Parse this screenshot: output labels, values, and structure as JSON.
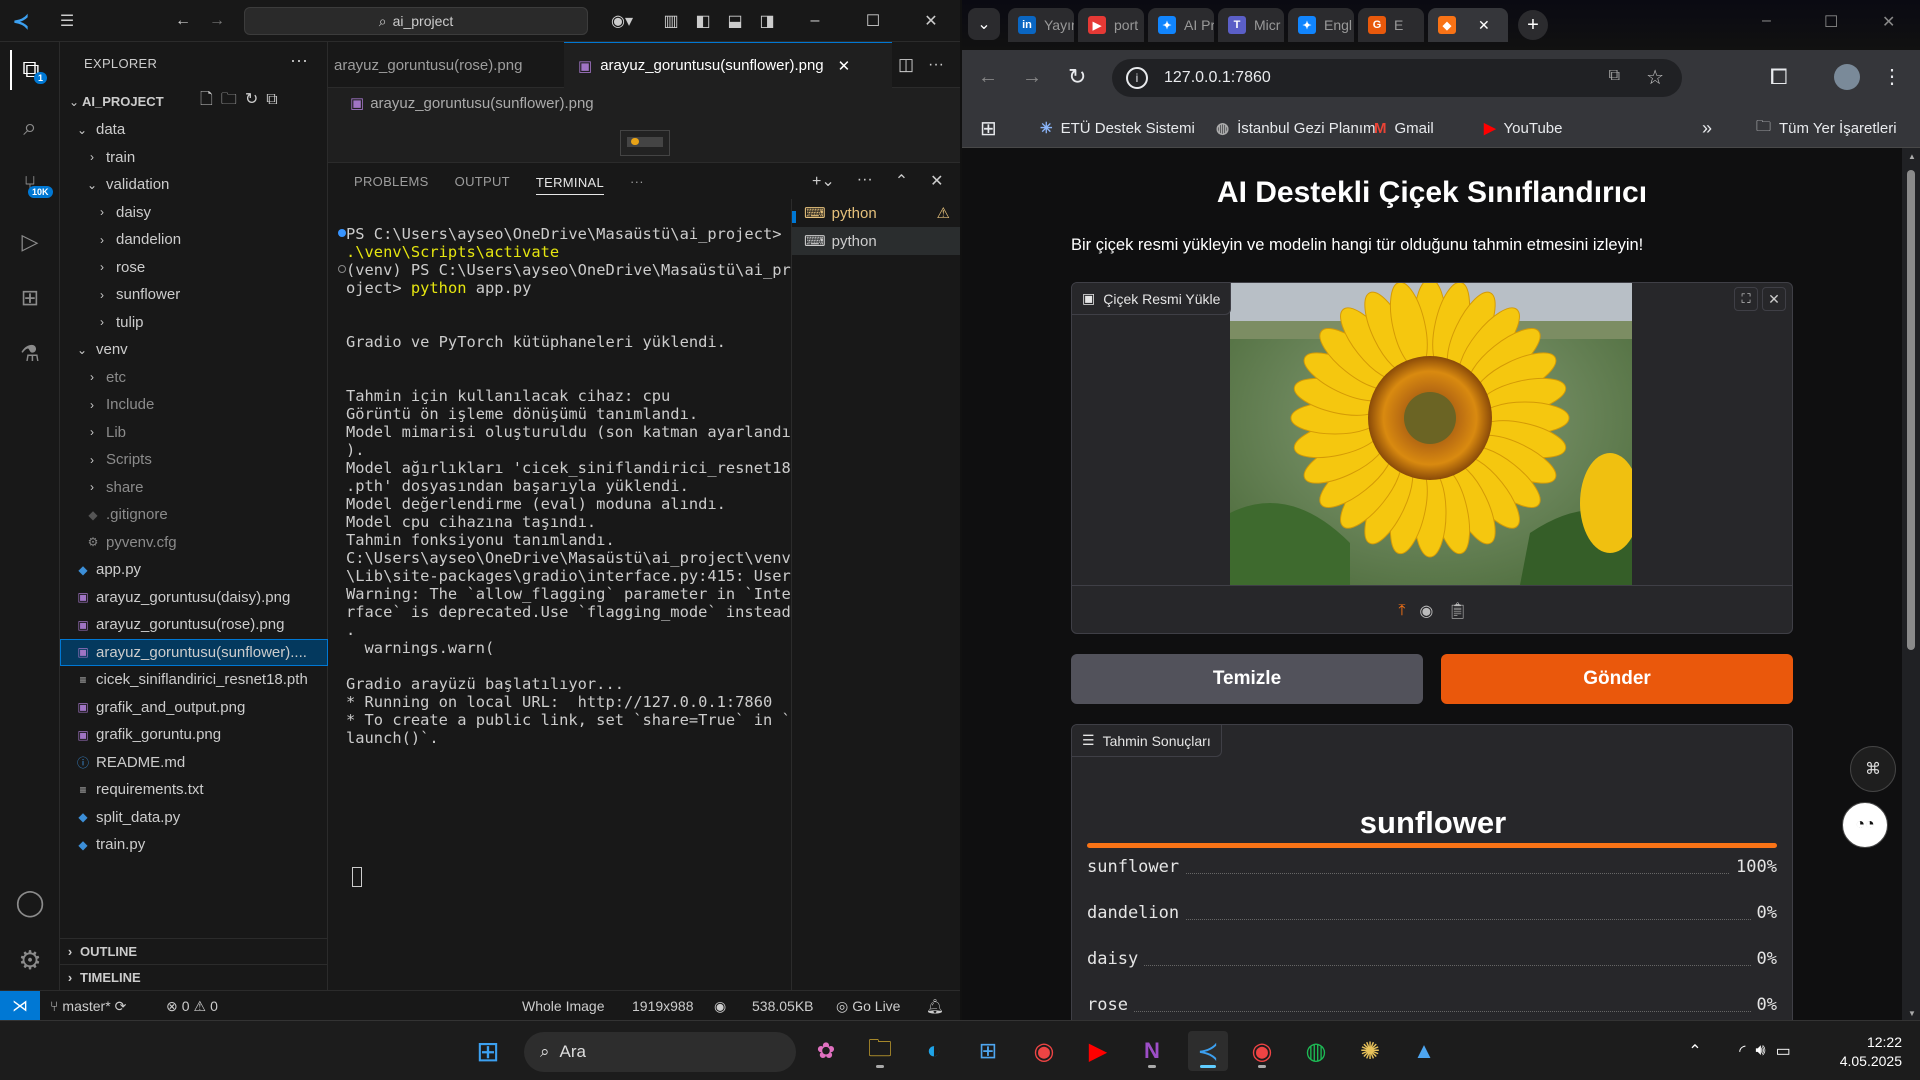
{
  "vscode": {
    "search_text": "ai_project",
    "explorer_label": "EXPLORER",
    "project_name": "AI_PROJECT",
    "source_control_badge": "10K",
    "explorer_badge": "1",
    "tree": [
      {
        "label": "data",
        "depth": 1,
        "type": "folder-open"
      },
      {
        "label": "train",
        "depth": 2,
        "type": "folder"
      },
      {
        "label": "validation",
        "depth": 2,
        "type": "folder-open"
      },
      {
        "label": "daisy",
        "depth": 3,
        "type": "folder"
      },
      {
        "label": "dandelion",
        "depth": 3,
        "type": "folder"
      },
      {
        "label": "rose",
        "depth": 3,
        "type": "folder"
      },
      {
        "label": "sunflower",
        "depth": 3,
        "type": "folder"
      },
      {
        "label": "tulip",
        "depth": 3,
        "type": "folder"
      },
      {
        "label": "venv",
        "depth": 1,
        "type": "folder-open"
      },
      {
        "label": "etc",
        "depth": 2,
        "type": "folder",
        "dim": true
      },
      {
        "label": "Include",
        "depth": 2,
        "type": "folder",
        "dim": true
      },
      {
        "label": "Lib",
        "depth": 2,
        "type": "folder",
        "dim": true
      },
      {
        "label": "Scripts",
        "depth": 2,
        "type": "folder",
        "dim": true
      },
      {
        "label": "share",
        "depth": 2,
        "type": "folder",
        "dim": true
      },
      {
        "label": ".gitignore",
        "depth": 2,
        "type": "gitignore",
        "dim": true
      },
      {
        "label": "pyvenv.cfg",
        "depth": 2,
        "type": "cfg",
        "dim": true
      },
      {
        "label": "app.py",
        "depth": 1,
        "type": "python"
      },
      {
        "label": "arayuz_goruntusu(daisy).png",
        "depth": 1,
        "type": "image"
      },
      {
        "label": "arayuz_goruntusu(rose).png",
        "depth": 1,
        "type": "image"
      },
      {
        "label": "arayuz_goruntusu(sunflower)....",
        "depth": 1,
        "type": "image",
        "selected": true
      },
      {
        "label": "cicek_siniflandirici_resnet18.pth",
        "depth": 1,
        "type": "text"
      },
      {
        "label": "grafik_and_output.png",
        "depth": 1,
        "type": "image"
      },
      {
        "label": "grafik_goruntu.png",
        "depth": 1,
        "type": "image"
      },
      {
        "label": "README.md",
        "depth": 1,
        "type": "info"
      },
      {
        "label": "requirements.txt",
        "depth": 1,
        "type": "text"
      },
      {
        "label": "split_data.py",
        "depth": 1,
        "type": "python"
      },
      {
        "label": "train.py",
        "depth": 1,
        "type": "python"
      }
    ],
    "outline_label": "OUTLINE",
    "timeline_label": "TIMELINE",
    "tab_inactive": "arayuz_goruntusu(rose).png",
    "tab_active": "arayuz_goruntusu(sunflower).png",
    "breadcrumb": "arayuz_goruntusu(sunflower).png",
    "panel_tabs": [
      "PROBLEMS",
      "OUTPUT",
      "TERMINAL"
    ],
    "terminal_lines": [
      {
        "parts": [
          [
            "PS C:\\Users\\ayseo\\OneDrive\\Masaüstü\\ai_project> ",
            "#cccccc"
          ]
        ]
      },
      {
        "parts": [
          [
            ".\\venv\\Scripts\\activate",
            "#e5e510"
          ]
        ]
      },
      {
        "parts": [
          [
            "(venv) ",
            "#cccccc"
          ],
          [
            "PS C:\\Users\\ayseo\\OneDrive\\Masaüstü\\ai_pr",
            "#cccccc"
          ]
        ]
      },
      {
        "parts": [
          [
            "oject> ",
            "#cccccc"
          ],
          [
            "python",
            "#e5e510"
          ],
          [
            " app.py",
            "#cccccc"
          ]
        ]
      },
      {
        "parts": [
          [
            "",
            "#cccccc"
          ]
        ]
      },
      {
        "parts": [
          [
            "",
            "#cccccc"
          ]
        ]
      },
      {
        "parts": [
          [
            "Gradio ve PyTorch kütüphaneleri yüklendi.",
            "#cccccc"
          ]
        ]
      },
      {
        "parts": [
          [
            "",
            "#cccccc"
          ]
        ]
      },
      {
        "parts": [
          [
            "",
            "#cccccc"
          ]
        ]
      },
      {
        "parts": [
          [
            "Tahmin için kullanılacak cihaz: cpu",
            "#cccccc"
          ]
        ]
      },
      {
        "parts": [
          [
            "Görüntü ön işleme dönüşümü tanımlandı.",
            "#cccccc"
          ]
        ]
      },
      {
        "parts": [
          [
            "Model mimarisi oluşturuldu (son katman ayarlandı",
            "#cccccc"
          ]
        ]
      },
      {
        "parts": [
          [
            ").",
            "#cccccc"
          ]
        ]
      },
      {
        "parts": [
          [
            "Model ağırlıkları 'cicek_siniflandirici_resnet18",
            "#cccccc"
          ]
        ]
      },
      {
        "parts": [
          [
            ".pth' dosyasından başarıyla yüklendi.",
            "#cccccc"
          ]
        ]
      },
      {
        "parts": [
          [
            "Model değerlendirme (eval) moduna alındı.",
            "#cccccc"
          ]
        ]
      },
      {
        "parts": [
          [
            "Model cpu cihazına taşındı.",
            "#cccccc"
          ]
        ]
      },
      {
        "parts": [
          [
            "Tahmin fonksiyonu tanımlandı.",
            "#cccccc"
          ]
        ]
      },
      {
        "parts": [
          [
            "C:\\Users\\ayseo\\OneDrive\\Masaüstü\\ai_project\\venv",
            "#cccccc"
          ]
        ]
      },
      {
        "parts": [
          [
            "\\Lib\\site-packages\\gradio\\interface.py:415: User",
            "#cccccc"
          ]
        ]
      },
      {
        "parts": [
          [
            "Warning: The `allow_flagging` parameter in `Inte",
            "#cccccc"
          ]
        ]
      },
      {
        "parts": [
          [
            "rface` is deprecated.Use `flagging_mode` instead",
            "#cccccc"
          ]
        ]
      },
      {
        "parts": [
          [
            ".",
            "#cccccc"
          ]
        ]
      },
      {
        "parts": [
          [
            "  warnings.warn(",
            "#cccccc"
          ]
        ]
      },
      {
        "parts": [
          [
            "",
            "#cccccc"
          ]
        ]
      },
      {
        "parts": [
          [
            "Gradio arayüzü başlatılıyor...",
            "#cccccc"
          ]
        ]
      },
      {
        "parts": [
          [
            "* Running on local URL:  http://127.0.0.1:7860",
            "#cccccc"
          ]
        ]
      },
      {
        "parts": [
          [
            "* To create a public link, set `share=True` in `",
            "#cccccc"
          ]
        ]
      },
      {
        "parts": [
          [
            "launch()`.",
            "#cccccc"
          ]
        ]
      }
    ],
    "terminals": [
      "python",
      "python"
    ],
    "status": {
      "branch": "master*",
      "errors": "0",
      "warnings": "0",
      "whole_image": "Whole Image",
      "dimensions": "1919x988",
      "size": "538.05KB",
      "golive": "Go Live"
    }
  },
  "chrome": {
    "tabs": [
      {
        "label": "Yayın",
        "icon": "linkedin-icon",
        "color": "#0a66c2",
        "glyph": "in"
      },
      {
        "label": "port",
        "icon": "play-icon",
        "color": "#e53935",
        "glyph": "▶"
      },
      {
        "label": "AI Pr",
        "icon": "butterfly-icon",
        "color": "#1185fe",
        "glyph": "✦"
      },
      {
        "label": "Micr",
        "icon": "teams-icon",
        "color": "#5b5fc7",
        "glyph": "T"
      },
      {
        "label": "Engl",
        "icon": "butterfly-icon",
        "color": "#1185fe",
        "glyph": "✦"
      },
      {
        "label": "E",
        "icon": "grammar-icon",
        "color": "#e8590c",
        "glyph": "G"
      },
      {
        "label": "",
        "icon": "gradio-icon",
        "color": "#f97316",
        "glyph": "◆"
      }
    ],
    "url": "127.0.0.1:7860",
    "bookmarks": [
      {
        "label": "ETÜ Destek Sistemi",
        "icon": "asterisk-icon"
      },
      {
        "label": "İstanbul Gezi Planım",
        "icon": "globe-icon"
      },
      {
        "label": "Gmail",
        "icon": "gmail-icon"
      },
      {
        "label": "YouTube",
        "icon": "youtube-icon"
      }
    ],
    "all_bookmarks": "Tüm Yer İşaretleri"
  },
  "app": {
    "title": "AI Destekli Çiçek Sınıflandırıcı",
    "description": "Bir çiçek resmi yükleyin ve modelin hangi tür olduğunu tahmin etmesini izleyin!",
    "upload_label": "Çiçek Resmi Yükle",
    "clear_button": "Temizle",
    "submit_button": "Gönder",
    "result_label": "Tahmin Sonuçları",
    "prediction": "sunflower",
    "confidences": [
      {
        "label": "sunflower",
        "percent": "100%",
        "value": 1.0
      },
      {
        "label": "dandelion",
        "percent": "0%",
        "value": 0
      },
      {
        "label": "daisy",
        "percent": "0%",
        "value": 0
      },
      {
        "label": "rose",
        "percent": "0%",
        "value": 0
      }
    ],
    "accent": "#f97316",
    "clear_color": "#52525b",
    "submit_color": "#ea580c"
  },
  "taskbar": {
    "search": "Ara",
    "time": "12:22",
    "date": "4.05.2025"
  }
}
